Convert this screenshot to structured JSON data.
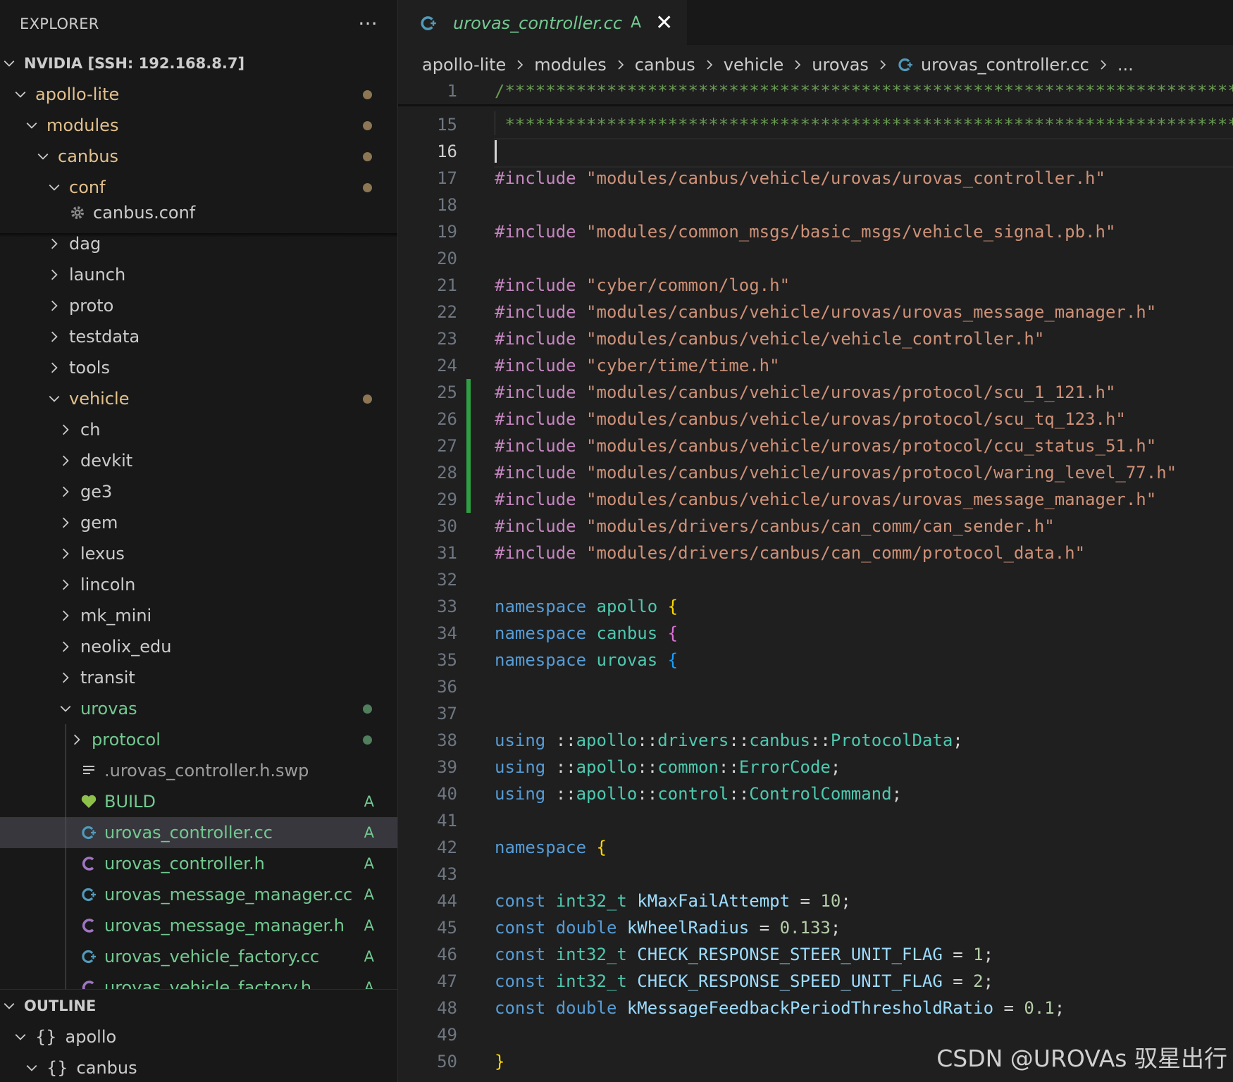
{
  "sidebar": {
    "title": "EXPLORER",
    "more_label": "···",
    "root_label": "NVIDIA [SSH: 192.168.8.7]",
    "items": [
      {
        "label": "apollo-lite",
        "type": "folder",
        "open": true,
        "depth": 1,
        "status": "mod"
      },
      {
        "label": "modules",
        "type": "folder",
        "open": true,
        "depth": 2,
        "status": "mod"
      },
      {
        "label": "canbus",
        "type": "folder",
        "open": true,
        "depth": 3,
        "status": "mod"
      },
      {
        "label": "conf",
        "type": "folder",
        "open": true,
        "depth": 4,
        "status": "mod"
      },
      {
        "label": "canbus.conf",
        "type": "file",
        "icon": "gear",
        "depth": 5,
        "status": "none"
      },
      {
        "label": "dag",
        "type": "folder",
        "open": false,
        "depth": 4,
        "status": "none"
      },
      {
        "label": "launch",
        "type": "folder",
        "open": false,
        "depth": 4,
        "status": "none"
      },
      {
        "label": "proto",
        "type": "folder",
        "open": false,
        "depth": 4,
        "status": "none"
      },
      {
        "label": "testdata",
        "type": "folder",
        "open": false,
        "depth": 4,
        "status": "none"
      },
      {
        "label": "tools",
        "type": "folder",
        "open": false,
        "depth": 4,
        "status": "none"
      },
      {
        "label": "vehicle",
        "type": "folder",
        "open": true,
        "depth": 4,
        "status": "mod"
      },
      {
        "label": "ch",
        "type": "folder",
        "open": false,
        "depth": 5,
        "status": "none"
      },
      {
        "label": "devkit",
        "type": "folder",
        "open": false,
        "depth": 5,
        "status": "none"
      },
      {
        "label": "ge3",
        "type": "folder",
        "open": false,
        "depth": 5,
        "status": "none"
      },
      {
        "label": "gem",
        "type": "folder",
        "open": false,
        "depth": 5,
        "status": "none"
      },
      {
        "label": "lexus",
        "type": "folder",
        "open": false,
        "depth": 5,
        "status": "none"
      },
      {
        "label": "lincoln",
        "type": "folder",
        "open": false,
        "depth": 5,
        "status": "none"
      },
      {
        "label": "mk_mini",
        "type": "folder",
        "open": false,
        "depth": 5,
        "status": "none"
      },
      {
        "label": "neolix_edu",
        "type": "folder",
        "open": false,
        "depth": 5,
        "status": "none"
      },
      {
        "label": "transit",
        "type": "folder",
        "open": false,
        "depth": 5,
        "status": "none"
      },
      {
        "label": "urovas",
        "type": "folder",
        "open": true,
        "depth": 5,
        "status": "add"
      },
      {
        "label": "protocol",
        "type": "folder",
        "open": false,
        "depth": 6,
        "status": "add"
      },
      {
        "label": ".urovas_controller.h.swp",
        "type": "file",
        "icon": "lines",
        "depth": 6,
        "status": "none"
      },
      {
        "label": "BUILD",
        "type": "file",
        "icon": "heart",
        "depth": 6,
        "status": "A"
      },
      {
        "label": "urovas_controller.cc",
        "type": "file",
        "icon": "cpp",
        "depth": 6,
        "status": "A",
        "selected": true
      },
      {
        "label": "urovas_controller.h",
        "type": "file",
        "icon": "c",
        "depth": 6,
        "status": "A"
      },
      {
        "label": "urovas_message_manager.cc",
        "type": "file",
        "icon": "cpp",
        "depth": 6,
        "status": "A"
      },
      {
        "label": "urovas_message_manager.h",
        "type": "file",
        "icon": "c",
        "depth": 6,
        "status": "A"
      },
      {
        "label": "urovas_vehicle_factory.cc",
        "type": "file",
        "icon": "cpp",
        "depth": 6,
        "status": "A"
      },
      {
        "label": "urovas_vehicle_factory.h",
        "type": "file",
        "icon": "c",
        "depth": 6,
        "status": "A"
      }
    ]
  },
  "outline": {
    "title": "OUTLINE",
    "items": [
      {
        "label": "apollo",
        "depth": 1
      },
      {
        "label": "canbus",
        "depth": 2
      }
    ]
  },
  "tab": {
    "label": "urovas_controller.cc",
    "status": "A",
    "close_label": "✕"
  },
  "breadcrumb": [
    "apollo-lite",
    "modules",
    "canbus",
    "vehicle",
    "urovas",
    "urovas_controller.cc",
    "..."
  ],
  "editor": {
    "current_line": 16,
    "diff_added_lines": [
      25,
      29
    ],
    "lines": [
      {
        "n": 1,
        "t": [
          [
            "cmt",
            "/****************************************************************************"
          ]
        ]
      },
      {
        "n": 15,
        "t": [
          [
            "cmt",
            " *****************************************************************************/"
          ]
        ]
      },
      {
        "n": 16,
        "t": []
      },
      {
        "n": 17,
        "t": [
          [
            "kw",
            "#include "
          ],
          [
            "str",
            "\"modules/canbus/vehicle/urovas/urovas_controller.h\""
          ]
        ]
      },
      {
        "n": 18,
        "t": []
      },
      {
        "n": 19,
        "t": [
          [
            "kw",
            "#include "
          ],
          [
            "str",
            "\"modules/common_msgs/basic_msgs/vehicle_signal.pb.h\""
          ]
        ]
      },
      {
        "n": 20,
        "t": []
      },
      {
        "n": 21,
        "t": [
          [
            "kw",
            "#include "
          ],
          [
            "str",
            "\"cyber/common/log.h\""
          ]
        ]
      },
      {
        "n": 22,
        "t": [
          [
            "kw",
            "#include "
          ],
          [
            "str",
            "\"modules/canbus/vehicle/urovas/urovas_message_manager.h\""
          ]
        ]
      },
      {
        "n": 23,
        "t": [
          [
            "kw",
            "#include "
          ],
          [
            "str",
            "\"modules/canbus/vehicle/vehicle_controller.h\""
          ]
        ]
      },
      {
        "n": 24,
        "t": [
          [
            "kw",
            "#include "
          ],
          [
            "str",
            "\"cyber/time/time.h\""
          ]
        ]
      },
      {
        "n": 25,
        "t": [
          [
            "kw",
            "#include "
          ],
          [
            "str",
            "\"modules/canbus/vehicle/urovas/protocol/scu_1_121.h\""
          ]
        ]
      },
      {
        "n": 26,
        "t": [
          [
            "kw",
            "#include "
          ],
          [
            "str",
            "\"modules/canbus/vehicle/urovas/protocol/scu_tq_123.h\""
          ]
        ]
      },
      {
        "n": 27,
        "t": [
          [
            "kw",
            "#include "
          ],
          [
            "str",
            "\"modules/canbus/vehicle/urovas/protocol/ccu_status_51.h\""
          ]
        ]
      },
      {
        "n": 28,
        "t": [
          [
            "kw",
            "#include "
          ],
          [
            "str",
            "\"modules/canbus/vehicle/urovas/protocol/waring_level_77.h\""
          ]
        ]
      },
      {
        "n": 29,
        "t": [
          [
            "kw",
            "#include "
          ],
          [
            "str",
            "\"modules/canbus/vehicle/urovas/urovas_message_manager.h\""
          ]
        ]
      },
      {
        "n": 30,
        "t": [
          [
            "kw",
            "#include "
          ],
          [
            "str",
            "\"modules/drivers/canbus/can_comm/can_sender.h\""
          ]
        ]
      },
      {
        "n": 31,
        "t": [
          [
            "kw",
            "#include "
          ],
          [
            "str",
            "\"modules/drivers/canbus/can_comm/protocol_data.h\""
          ]
        ]
      },
      {
        "n": 32,
        "t": []
      },
      {
        "n": 33,
        "t": [
          [
            "blue",
            "namespace "
          ],
          [
            "ns",
            "apollo "
          ],
          [
            "b1",
            "{"
          ]
        ]
      },
      {
        "n": 34,
        "t": [
          [
            "blue",
            "namespace "
          ],
          [
            "ns",
            "canbus "
          ],
          [
            "b2",
            "{"
          ]
        ]
      },
      {
        "n": 35,
        "t": [
          [
            "blue",
            "namespace "
          ],
          [
            "ns",
            "urovas "
          ],
          [
            "b3",
            "{"
          ]
        ]
      },
      {
        "n": 36,
        "t": []
      },
      {
        "n": 37,
        "t": []
      },
      {
        "n": 38,
        "t": [
          [
            "blue",
            "using "
          ],
          [
            "p",
            "::"
          ],
          [
            "ns",
            "apollo"
          ],
          [
            "p",
            "::"
          ],
          [
            "ns",
            "drivers"
          ],
          [
            "p",
            "::"
          ],
          [
            "ns",
            "canbus"
          ],
          [
            "p",
            "::"
          ],
          [
            "type",
            "ProtocolData"
          ],
          [
            "p",
            ";"
          ]
        ]
      },
      {
        "n": 39,
        "t": [
          [
            "blue",
            "using "
          ],
          [
            "p",
            "::"
          ],
          [
            "ns",
            "apollo"
          ],
          [
            "p",
            "::"
          ],
          [
            "ns",
            "common"
          ],
          [
            "p",
            "::"
          ],
          [
            "type",
            "ErrorCode"
          ],
          [
            "p",
            ";"
          ]
        ]
      },
      {
        "n": 40,
        "t": [
          [
            "blue",
            "using "
          ],
          [
            "p",
            "::"
          ],
          [
            "ns",
            "apollo"
          ],
          [
            "p",
            "::"
          ],
          [
            "ns",
            "control"
          ],
          [
            "p",
            "::"
          ],
          [
            "type",
            "ControlCommand"
          ],
          [
            "p",
            ";"
          ]
        ]
      },
      {
        "n": 41,
        "t": []
      },
      {
        "n": 42,
        "t": [
          [
            "blue",
            "namespace "
          ],
          [
            "b1",
            "{"
          ]
        ]
      },
      {
        "n": 43,
        "t": []
      },
      {
        "n": 44,
        "t": [
          [
            "blue",
            "const "
          ],
          [
            "type",
            "int32_t "
          ],
          [
            "var",
            "kMaxFailAttempt"
          ],
          [
            "p",
            " = "
          ],
          [
            "num",
            "10"
          ],
          [
            "p",
            ";"
          ]
        ]
      },
      {
        "n": 45,
        "t": [
          [
            "blue",
            "const "
          ],
          [
            "blue",
            "double "
          ],
          [
            "var",
            "kWheelRadius"
          ],
          [
            "p",
            " = "
          ],
          [
            "num",
            "0.133"
          ],
          [
            "p",
            ";"
          ]
        ]
      },
      {
        "n": 46,
        "t": [
          [
            "blue",
            "const "
          ],
          [
            "type",
            "int32_t "
          ],
          [
            "var",
            "CHECK_RESPONSE_STEER_UNIT_FLAG"
          ],
          [
            "p",
            " = "
          ],
          [
            "num",
            "1"
          ],
          [
            "p",
            ";"
          ]
        ]
      },
      {
        "n": 47,
        "t": [
          [
            "blue",
            "const "
          ],
          [
            "type",
            "int32_t "
          ],
          [
            "var",
            "CHECK_RESPONSE_SPEED_UNIT_FLAG"
          ],
          [
            "p",
            " = "
          ],
          [
            "num",
            "2"
          ],
          [
            "p",
            ";"
          ]
        ]
      },
      {
        "n": 48,
        "t": [
          [
            "blue",
            "const "
          ],
          [
            "blue",
            "double "
          ],
          [
            "var",
            "kMessageFeedbackPeriodThresholdRatio"
          ],
          [
            "p",
            " = "
          ],
          [
            "num",
            "0.1"
          ],
          [
            "p",
            ";"
          ]
        ]
      },
      {
        "n": 49,
        "t": []
      },
      {
        "n": 50,
        "t": [
          [
            "b1",
            "}"
          ]
        ]
      }
    ]
  },
  "watermark": "CSDN @UROVAs 驭星出行",
  "colors": {
    "modified": "#e2c08d",
    "added": "#73c991",
    "diff_bar": "#2ea043",
    "cpp_icon": "#519aba",
    "c_icon": "#a074c4",
    "build_icon": "#8dc149"
  }
}
